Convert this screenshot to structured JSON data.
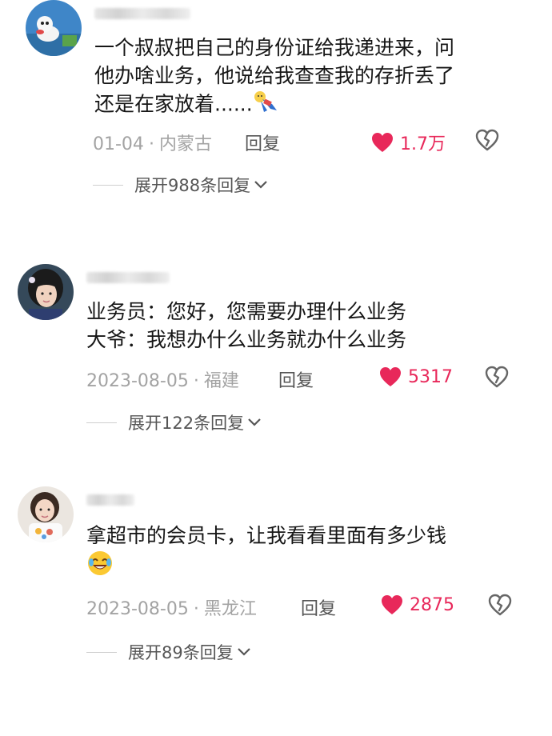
{
  "comments": [
    {
      "lines": [
        "一个叔叔把自己的身份证给我递进来，问",
        "他办啥业务，他说给我查查我的存折丢了",
        "还是在家放着......"
      ],
      "date": "01-04",
      "location": "内蒙古",
      "reply_label": "回复",
      "likes": "1.7万",
      "expand_label": "展开988条回复",
      "trailing_icon": "person-falling-icon"
    },
    {
      "lines": [
        "业务员：您好，您需要办理什么业务",
        "大爷：我想办什么业务就办什么业务"
      ],
      "date": "2023-08-05",
      "location": "福建",
      "reply_label": "回复",
      "likes": "5317",
      "expand_label": "展开122条回复"
    },
    {
      "lines": [
        "拿超市的会员卡，让我看看里面有多少钱"
      ],
      "date": "2023-08-05",
      "location": "黑龙江",
      "reply_label": "回复",
      "likes": "2875",
      "expand_label": "展开89条回复",
      "trailing_icon": "laughing-crying-emoji"
    }
  ],
  "colors": {
    "like": "#e8285a",
    "meta": "#a3a3a3",
    "text": "#161616",
    "secondary": "#555555"
  },
  "separator": "·"
}
